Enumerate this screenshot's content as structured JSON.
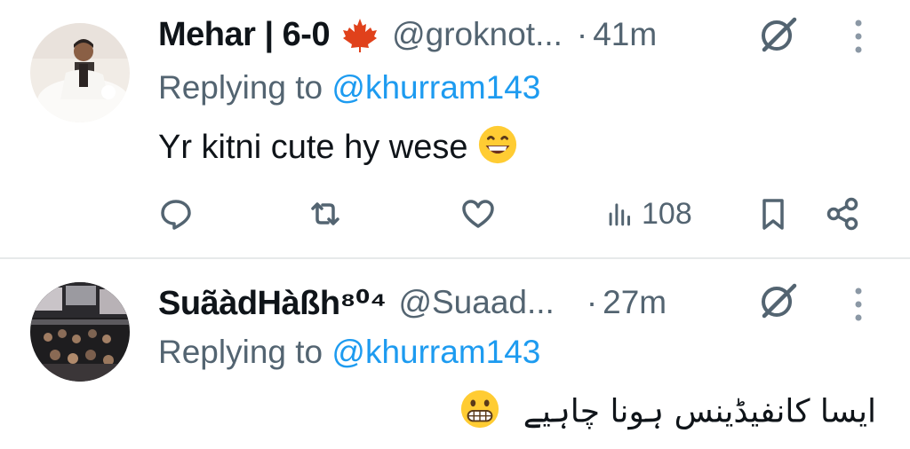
{
  "tweets": [
    {
      "name": "Mehar | 6-0",
      "handle": "@groknot...",
      "dot": "·",
      "time": "41m",
      "replying_label": "Replying to",
      "replying_to": "@khurram143",
      "text": "Yr kitni cute hy wese",
      "views": "108"
    },
    {
      "name": "SuãàdHàßh⁸⁰⁴",
      "handle": "@Suaad...",
      "dot": "·",
      "time": "27m",
      "replying_label": "Replying to",
      "replying_to": "@khurram143",
      "text": "ایسا کانفیڈینس ہونا چاہیے"
    }
  ],
  "colors": {
    "text": "#0f1419",
    "secondary": "#536471",
    "accent": "#1d9bf0",
    "divider": "#e7e9ea"
  },
  "icons": [
    "maple-leaf-icon",
    "grok-icon",
    "more-icon",
    "reply-icon",
    "retweet-icon",
    "like-icon",
    "views-icon",
    "bookmark-icon",
    "share-icon",
    "grinning-emoji",
    "grimacing-emoji"
  ]
}
